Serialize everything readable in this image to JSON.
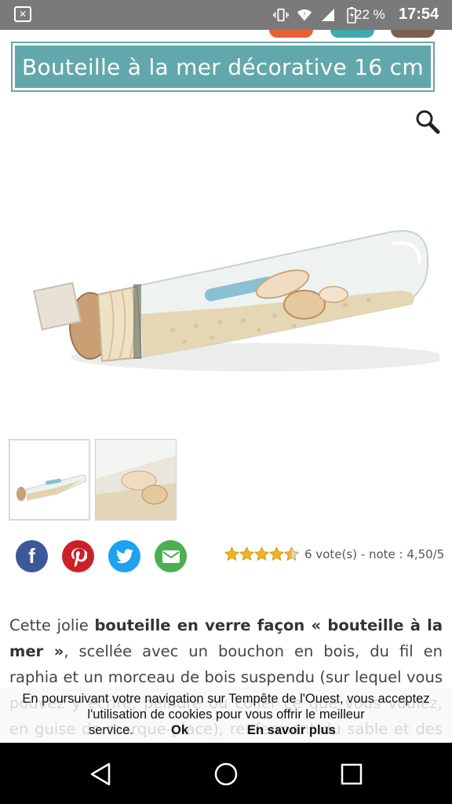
{
  "status_bar": {
    "notification_icon": "close-box-icon",
    "icons": [
      "vibrate-icon",
      "wifi-icon",
      "signal-icon",
      "battery-icon"
    ],
    "battery": "22 %",
    "time": "17:54"
  },
  "product": {
    "title": "Bouteille à la mer décorative 16 cm",
    "zoom_icon": "magnifier-icon",
    "image_alt": "bottle-with-sand-and-shells"
  },
  "thumbnails": [
    "bottle-full-thumbnail",
    "shells-closeup-thumbnail"
  ],
  "share": {
    "buttons": [
      {
        "name": "facebook",
        "glyph": "f",
        "color": "#3b5998"
      },
      {
        "name": "pinterest",
        "glyph": "P",
        "color": "#cb2027"
      },
      {
        "name": "twitter",
        "glyph": "t",
        "color": "#1da1f2"
      },
      {
        "name": "email",
        "glyph": "✉",
        "color": "#4caf50"
      }
    ]
  },
  "rating": {
    "stars": 4.5,
    "text": "6 vote(s) - note : 4,50/5"
  },
  "description": {
    "t1": "Cette jolie ",
    "b1": "bouteille en verre façon « bouteille à la mer »",
    "t2": ", scellée avec un bouchon en bois, du fil en raphia et un morceau de bois suspendu (sur lequel vous pouvez y écrire, peindre ou coller ce que vous voulez, en guise de marque-place), renfermant du sable et des coquillages"
  },
  "cookie": {
    "line1": "En poursuivant votre navigation sur Tempête de l'Ouest, vous acceptez",
    "line2": "l'utilisation de cookies pour vous offrir le meilleur",
    "service": "service.",
    "ok": "Ok",
    "more": "En savoir plus"
  },
  "navbar": {
    "back": "back-icon",
    "home": "home-icon",
    "recents": "recents-icon"
  }
}
